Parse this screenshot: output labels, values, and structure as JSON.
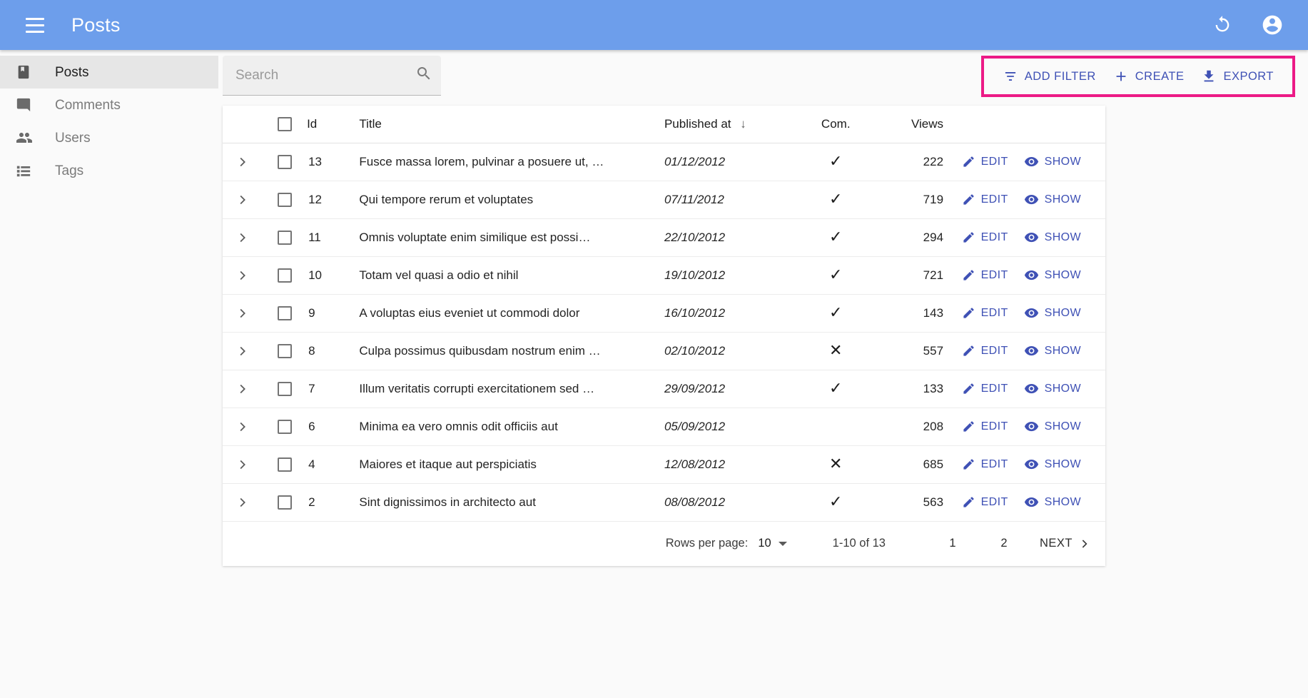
{
  "appbar": {
    "title": "Posts",
    "menu_icon": "hamburger-menu-icon",
    "refresh_icon": "refresh-icon",
    "account_icon": "account-circle-icon",
    "background": "#6d9eeb"
  },
  "sidebar": {
    "items": [
      {
        "label": "Posts",
        "icon": "book-icon",
        "active": true
      },
      {
        "label": "Comments",
        "icon": "comment-icon",
        "active": false
      },
      {
        "label": "Users",
        "icon": "people-icon",
        "active": false
      },
      {
        "label": "Tags",
        "icon": "list-icon",
        "active": false
      }
    ]
  },
  "search": {
    "value": "",
    "placeholder": "Search",
    "icon": "search-icon"
  },
  "toolbar": {
    "highlight_color": "#ec1a86",
    "accent_color": "#3f51b5",
    "add_filter_label": "ADD FILTER",
    "add_filter_icon": "filter-list-icon",
    "create_label": "CREATE",
    "create_icon": "plus-icon",
    "export_label": "EXPORT",
    "export_icon": "download-icon"
  },
  "table": {
    "headers": {
      "id": "Id",
      "title": "Title",
      "published_at": "Published at",
      "sort_indicator": "↓",
      "comments": "Com.",
      "views": "Views"
    },
    "row_actions": {
      "edit_label": "EDIT",
      "edit_icon": "pencil-icon",
      "show_label": "SHOW",
      "show_icon": "eye-icon"
    },
    "rows": [
      {
        "id": "13",
        "title": "Fusce massa lorem, pulvinar a posuere ut, …",
        "published_at": "01/12/2012",
        "commentable": "✓",
        "views": "222"
      },
      {
        "id": "12",
        "title": "Qui tempore rerum et voluptates",
        "published_at": "07/11/2012",
        "commentable": "✓",
        "views": "719"
      },
      {
        "id": "11",
        "title": "Omnis voluptate enim similique est possi…",
        "published_at": "22/10/2012",
        "commentable": "✓",
        "views": "294"
      },
      {
        "id": "10",
        "title": "Totam vel quasi a odio et nihil",
        "published_at": "19/10/2012",
        "commentable": "✓",
        "views": "721"
      },
      {
        "id": "9",
        "title": "A voluptas eius eveniet ut commodi dolor",
        "published_at": "16/10/2012",
        "commentable": "✓",
        "views": "143"
      },
      {
        "id": "8",
        "title": "Culpa possimus quibusdam nostrum enim …",
        "published_at": "02/10/2012",
        "commentable": "✕",
        "views": "557"
      },
      {
        "id": "7",
        "title": "Illum veritatis corrupti exercitationem sed …",
        "published_at": "29/09/2012",
        "commentable": "✓",
        "views": "133"
      },
      {
        "id": "6",
        "title": "Minima ea vero omnis odit officiis aut",
        "published_at": "05/09/2012",
        "commentable": "",
        "views": "208"
      },
      {
        "id": "4",
        "title": "Maiores et itaque aut perspiciatis",
        "published_at": "12/08/2012",
        "commentable": "✕",
        "views": "685"
      },
      {
        "id": "2",
        "title": "Sint dignissimos in architecto aut",
        "published_at": "08/08/2012",
        "commentable": "✓",
        "views": "563"
      }
    ]
  },
  "pagination": {
    "rows_per_page_label": "Rows per page:",
    "rows_per_page_value": "10",
    "range_label": "1-10 of 13",
    "page_1": "1",
    "page_2": "2",
    "next_label": "NEXT",
    "next_icon": "chevron-right-icon"
  }
}
